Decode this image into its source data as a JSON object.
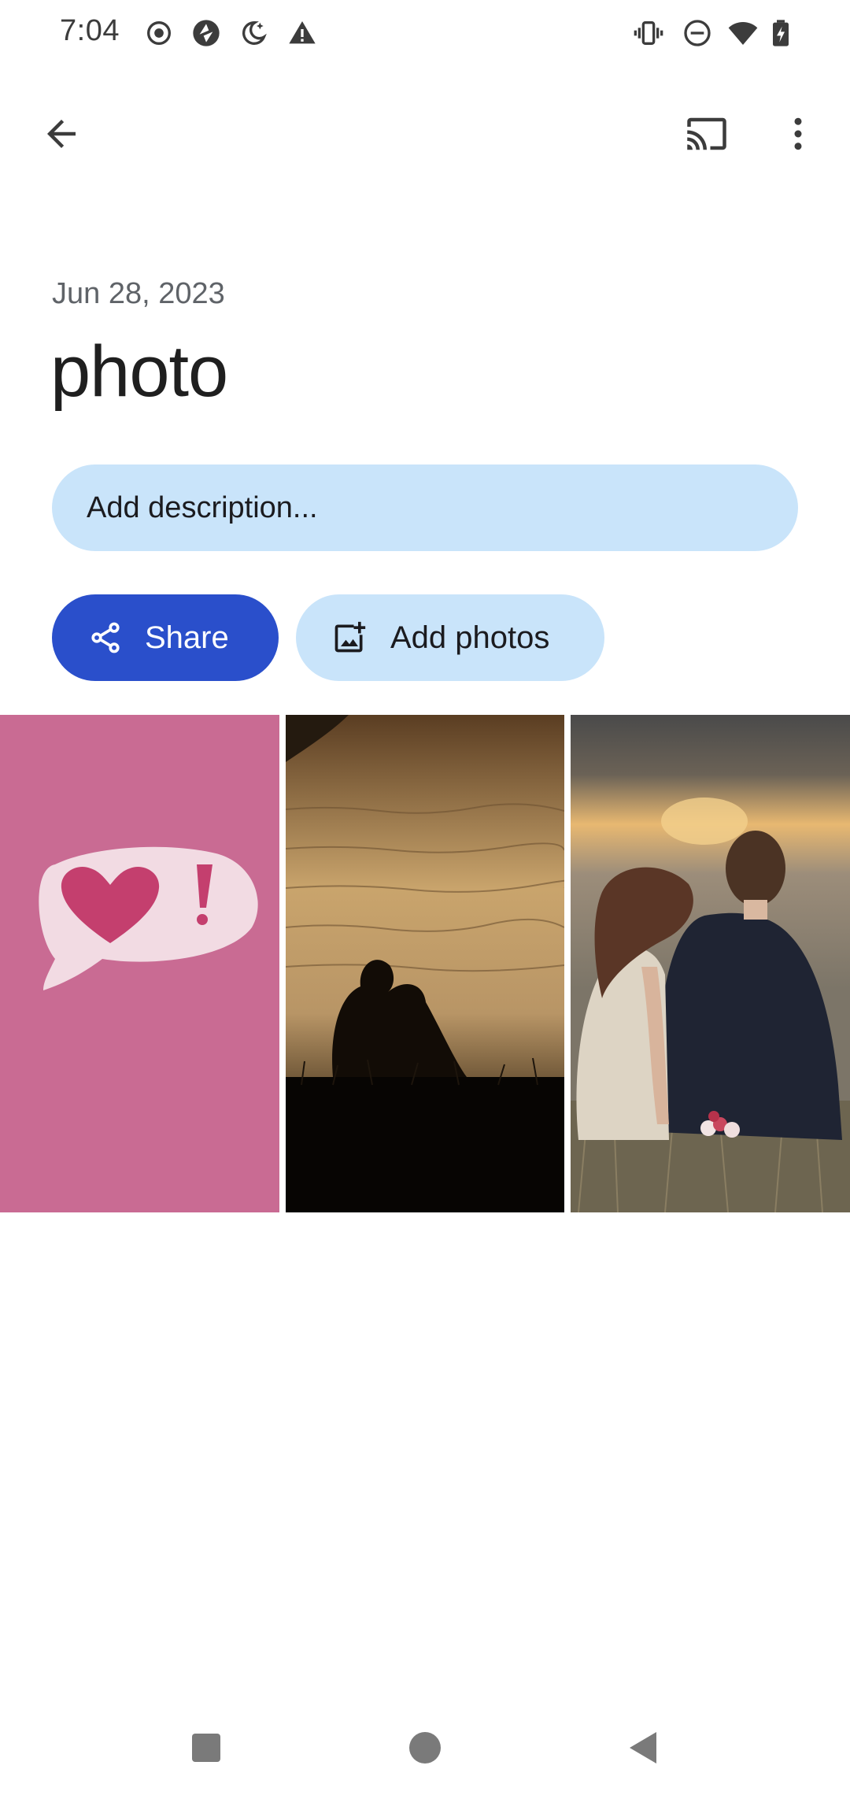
{
  "status_bar": {
    "time": "7:04",
    "left_icons": [
      "record-icon",
      "vpn-icon",
      "bedtime-icon",
      "warning-icon"
    ],
    "right_icons": [
      "vibrate-icon",
      "do-not-disturb-icon",
      "wifi-icon",
      "battery-charging-icon"
    ]
  },
  "app_bar": {
    "back_icon": "arrow-back-icon",
    "cast_icon": "cast-icon",
    "more_icon": "more-vert-icon"
  },
  "album": {
    "date": "Jun 28, 2023",
    "title": "photo"
  },
  "description": {
    "placeholder": "Add description..."
  },
  "actions": {
    "share_label": "Share",
    "add_photos_label": "Add photos"
  },
  "photos": [
    {
      "subject": "pink heart speech bubble"
    },
    {
      "subject": "couple silhouette by lake at sunset"
    },
    {
      "subject": "couple sitting by lake at sunset"
    }
  ],
  "colors": {
    "accent": "#2a4fcb",
    "tonal": "#c9e4fa",
    "text_primary": "#1f1f1f",
    "text_secondary": "#5f6368"
  },
  "nav_bar": {
    "icons": [
      "recents-square-icon",
      "home-circle-icon",
      "back-triangle-icon"
    ]
  }
}
